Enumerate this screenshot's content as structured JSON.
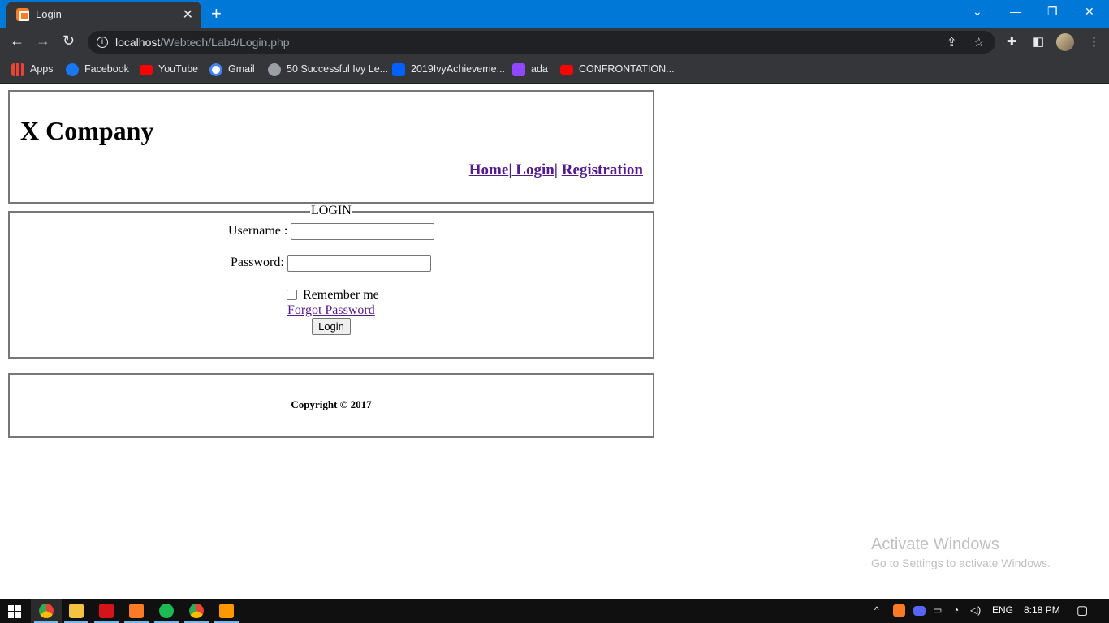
{
  "browser": {
    "tab_title": "Login",
    "url_host": "localhost",
    "url_path": "/Webtech/Lab4/Login.php",
    "bookmarks": [
      {
        "label": "Apps",
        "icon": "apps-grid-icon",
        "color": "#ea4335"
      },
      {
        "label": "Facebook",
        "icon": "facebook-icon",
        "color": "#1877f2"
      },
      {
        "label": "YouTube",
        "icon": "youtube-icon",
        "color": "#ff0000"
      },
      {
        "label": "Gmail",
        "icon": "google-icon",
        "color": "#ffffff"
      },
      {
        "label": "50 Successful Ivy Le...",
        "icon": "globe-icon",
        "color": "#9aa0a6"
      },
      {
        "label": "2019IvyAchieveme...",
        "icon": "dropbox-icon",
        "color": "#0061ff"
      },
      {
        "label": "ada",
        "icon": "twitch-icon",
        "color": "#9146ff"
      },
      {
        "label": "CONFRONTATION...",
        "icon": "youtube-icon",
        "color": "#ff0000"
      }
    ]
  },
  "page": {
    "company": "X Company",
    "nav": {
      "home": "Home",
      "login": "Login",
      "registration": "Registration",
      "sep": "|"
    },
    "login_legend": "LOGIN",
    "username_label": "Username :",
    "username_value": "",
    "password_label": "Password:",
    "password_value": "",
    "remember_label": "Remember me",
    "remember_checked": false,
    "forgot_link": "Forgot Password",
    "login_button": "Login",
    "copyright": "Copyright © 2017"
  },
  "watermark": {
    "line1": "Activate Windows",
    "line2": "Go to Settings to activate Windows."
  },
  "taskbar": {
    "language": "ENG",
    "time": "8:18 PM",
    "apps": [
      {
        "name": "chrome-app",
        "color": "#4285f4",
        "active": true
      },
      {
        "name": "file-explorer-app",
        "color": "#f5c242",
        "active": false
      },
      {
        "name": "acrobat-app",
        "color": "#d4141a",
        "active": false
      },
      {
        "name": "xampp-app",
        "color": "#fb7a24",
        "active": false
      },
      {
        "name": "spotify-app",
        "color": "#1db954",
        "active": false
      },
      {
        "name": "chrome-app-2",
        "color": "#4285f4",
        "active": false
      },
      {
        "name": "sublime-app",
        "color": "#ff9800",
        "active": false
      }
    ]
  }
}
